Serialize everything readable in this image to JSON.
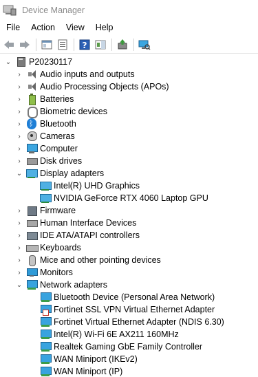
{
  "window": {
    "title": "Device Manager"
  },
  "menu": [
    "File",
    "Action",
    "View",
    "Help"
  ],
  "toolbar": {
    "buttons": [
      "back-icon",
      "forward-icon",
      "tree-view-icon",
      "properties-icon",
      "help-icon",
      "action-pane-icon",
      "update-driver-icon",
      "scan-hardware-icon"
    ]
  },
  "tree": {
    "root": "P20230117",
    "categories": [
      {
        "label": "Audio inputs and outputs",
        "icon": "speaker-icon",
        "expanded": false
      },
      {
        "label": "Audio Processing Objects (APOs)",
        "icon": "speaker-icon",
        "expanded": false
      },
      {
        "label": "Batteries",
        "icon": "battery-icon",
        "expanded": false
      },
      {
        "label": "Biometric devices",
        "icon": "fingerprint-icon",
        "expanded": false
      },
      {
        "label": "Bluetooth",
        "icon": "bluetooth-icon",
        "expanded": false
      },
      {
        "label": "Cameras",
        "icon": "camera-icon",
        "expanded": false
      },
      {
        "label": "Computer",
        "icon": "computer-icon",
        "expanded": false
      },
      {
        "label": "Disk drives",
        "icon": "disk-icon",
        "expanded": false
      },
      {
        "label": "Display adapters",
        "icon": "display-adapter-icon",
        "expanded": true,
        "children": [
          "Intel(R) UHD Graphics",
          "NVIDIA GeForce RTX 4060 Laptop GPU"
        ]
      },
      {
        "label": "Firmware",
        "icon": "firmware-icon",
        "expanded": false
      },
      {
        "label": "Human Interface Devices",
        "icon": "hid-icon",
        "expanded": false
      },
      {
        "label": "IDE ATA/ATAPI controllers",
        "icon": "ide-icon",
        "expanded": false
      },
      {
        "label": "Keyboards",
        "icon": "keyboard-icon",
        "expanded": false
      },
      {
        "label": "Mice and other pointing devices",
        "icon": "mouse-icon",
        "expanded": false
      },
      {
        "label": "Monitors",
        "icon": "monitor-icon",
        "expanded": false
      },
      {
        "label": "Network adapters",
        "icon": "network-adapter-icon",
        "expanded": true,
        "children": [
          "Bluetooth Device (Personal Area Network)",
          "Fortinet SSL VPN Virtual Ethernet Adapter",
          "Fortinet Virtual Ethernet Adapter (NDIS 6.30)",
          "Intel(R) Wi-Fi 6E AX211 160MHz",
          "Realtek Gaming GbE Family Controller",
          "WAN Miniport (IKEv2)",
          "WAN Miniport (IP)"
        ]
      }
    ]
  }
}
